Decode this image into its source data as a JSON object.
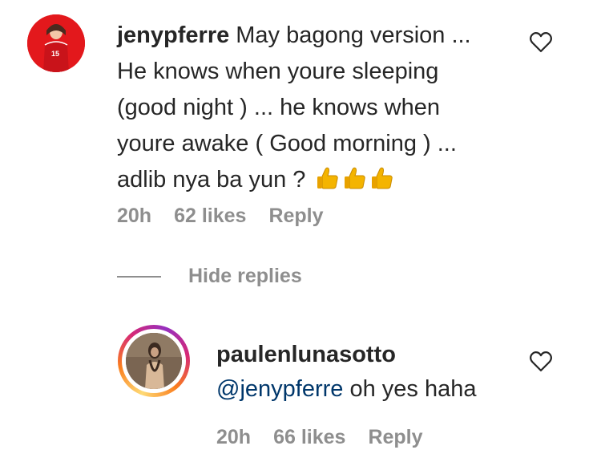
{
  "comment": {
    "username": "jenypferre",
    "text_line1": "May bagong version ...",
    "text_rest": "He knows when youre sleeping (good night ) ... he knows when youre awake ( Good morning ) ... adlib nya ba yun ?",
    "emojis": [
      "thumbs-up",
      "thumbs-up",
      "thumbs-up"
    ],
    "time": "20h",
    "likes": "62 likes",
    "reply_label": "Reply"
  },
  "hide_replies_label": "Hide replies",
  "reply": {
    "username": "paulenlunasotto",
    "mention": "@jenypferre",
    "text": "oh yes haha",
    "time": "20h",
    "likes": "66 likes",
    "reply_label": "Reply"
  },
  "colors": {
    "text": "#262626",
    "meta": "#8e8e8e",
    "mention": "#00376b",
    "avatar_bg": "#e3181c"
  },
  "icons": {
    "like": "heart-outline-icon",
    "emoji": "thumbs-up-emoji"
  }
}
